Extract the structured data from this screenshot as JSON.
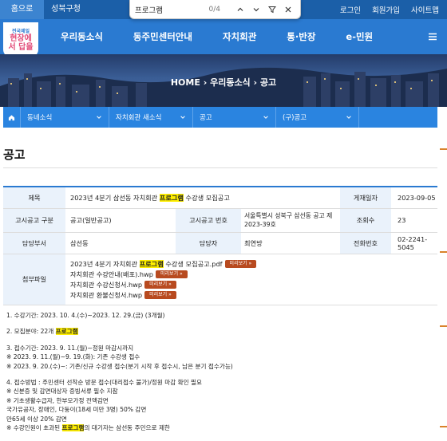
{
  "topbar": {
    "tabs": [
      "홈으로",
      "성북구청"
    ],
    "links": [
      "로그인",
      "회원가입",
      "사이트맵"
    ]
  },
  "findbar": {
    "query": "프로그램",
    "count": "0/4"
  },
  "header": {
    "logo_top": "전국제일",
    "logo_main": "현장에서 답을",
    "nav": [
      "우리동소식",
      "동주민센터안내",
      "자치회관",
      "통·반장",
      "e-민원"
    ]
  },
  "banner": {
    "home": "HOME",
    "crumb1": "우리동소식",
    "crumb2": "공고"
  },
  "subnav": [
    "동네소식",
    "자치회관 새소식",
    "공고",
    "(구)공고"
  ],
  "page": {
    "title": "공고"
  },
  "info": {
    "labels": {
      "title": "제목",
      "date": "게재일자",
      "type": "고시공고 구분",
      "no": "고시공고 번호",
      "views": "조회수",
      "dept": "담당부서",
      "person": "담당자",
      "phone": "전화번호",
      "files": "첨부파일"
    },
    "title_pre": "2023년 4분기 삼선동 자치회관 ",
    "title_hl": "프로그램",
    "title_post": " 수강생 모집공고",
    "date": "2023-09-05",
    "type": "공고(일반공고)",
    "no": "서울특별시 성북구 삼선동 공고 제2023-39호",
    "views": "23",
    "dept": "삼선동",
    "person": "최연방",
    "phone": "02-2241-5045",
    "files": [
      {
        "pre": "2023년 4분기 자치회관 ",
        "hl": "프로그램",
        "post": " 수강생 모집공고.pdf",
        "btn": "미리보기"
      },
      {
        "pre": "자치회관 수강안내(배포).hwp",
        "hl": "",
        "post": "",
        "btn": "미리보기"
      },
      {
        "pre": "자치회관 수강신청서.hwp",
        "hl": "",
        "post": "",
        "btn": "미리보기"
      },
      {
        "pre": "자치회관 환불신청서.hwp",
        "hl": "",
        "post": "",
        "btn": "미리보기"
      }
    ]
  },
  "body": {
    "l1": "1. 수강기간: 2023. 10. 4.(수)~2023. 12. 29.(금) (3개월)",
    "l2_pre": "2. 모집분야: 22개 ",
    "l2_hl": "프로그램",
    "l3": "3. 접수기간: 2023. 9. 11.(월)~정원 마감시까지",
    "l4": "※ 2023. 9. 11.(월)~9. 19.(화): 기존 수강생 접수",
    "l5": "※ 2023. 9. 20.(수)~: 기존/신규 수강생 접수(분기 시작 후 접수시, 남은 분기 접수가능)",
    "l6": "4. 접수방법 : 주민센터 선착순 방문 접수(대리접수 불가)/정원 마감 확인 필요",
    "l7": "※ 신분증 및 감면대상자 증빙서류 필수 지참",
    "l8": "※ 기초생활수급자, 한부모가정 전액감면",
    "l9": "국가유공자, 장애인, 다둥이(18세 미만 3명) 50% 감면",
    "l10": "만65세 이상 20% 감면",
    "l11_pre": "※ 수강인원이 초과된 ",
    "l11_hl": "프로그램",
    "l11_post": "의 대기자는 삼선동 주민으로 제한"
  }
}
